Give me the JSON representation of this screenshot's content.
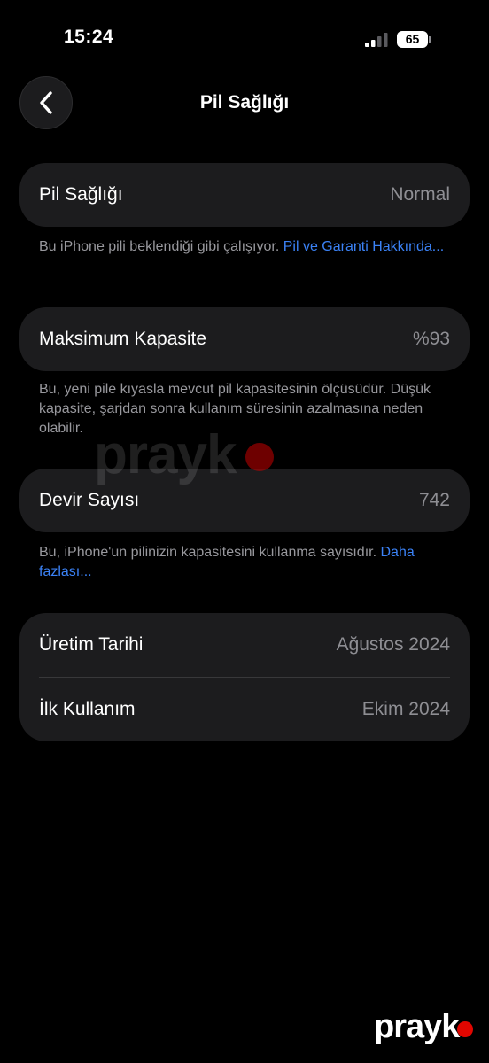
{
  "status_bar": {
    "time": "15:24",
    "battery_level": "65"
  },
  "nav": {
    "title": "Pil Sağlığı",
    "back_icon": "chevron-left-icon"
  },
  "battery_health": {
    "label": "Pil Sağlığı",
    "value": "Normal",
    "note": "Bu iPhone pili beklendiği gibi çalışıyor. ",
    "note_link": "Pil ve Garanti Hakkında..."
  },
  "max_capacity": {
    "label": "Maksimum Kapasite",
    "value": "%93",
    "note": "Bu, yeni pile kıyasla mevcut pil kapasitesinin ölçüsüdür. Düşük kapasite, şarjdan sonra kullanım süresinin azalmasına neden olabilir."
  },
  "cycle_count": {
    "label": "Devir Sayısı",
    "value": "742",
    "note": "Bu, iPhone'un pilinizin kapasitesini kullanma sayısıdır. ",
    "note_link": "Daha fazlası..."
  },
  "dates": {
    "manufacture_label": "Üretim Tarihi",
    "manufacture_value": "Ağustos 2024",
    "first_use_label": "İlk Kullanım",
    "first_use_value": "Ekim 2024"
  },
  "watermark": {
    "text": "prayk"
  },
  "colors": {
    "background": "#000000",
    "card": "#1c1c1e",
    "secondary_text": "#8e8e93",
    "link": "#3b82f6",
    "brand_dot": "#e10600"
  }
}
